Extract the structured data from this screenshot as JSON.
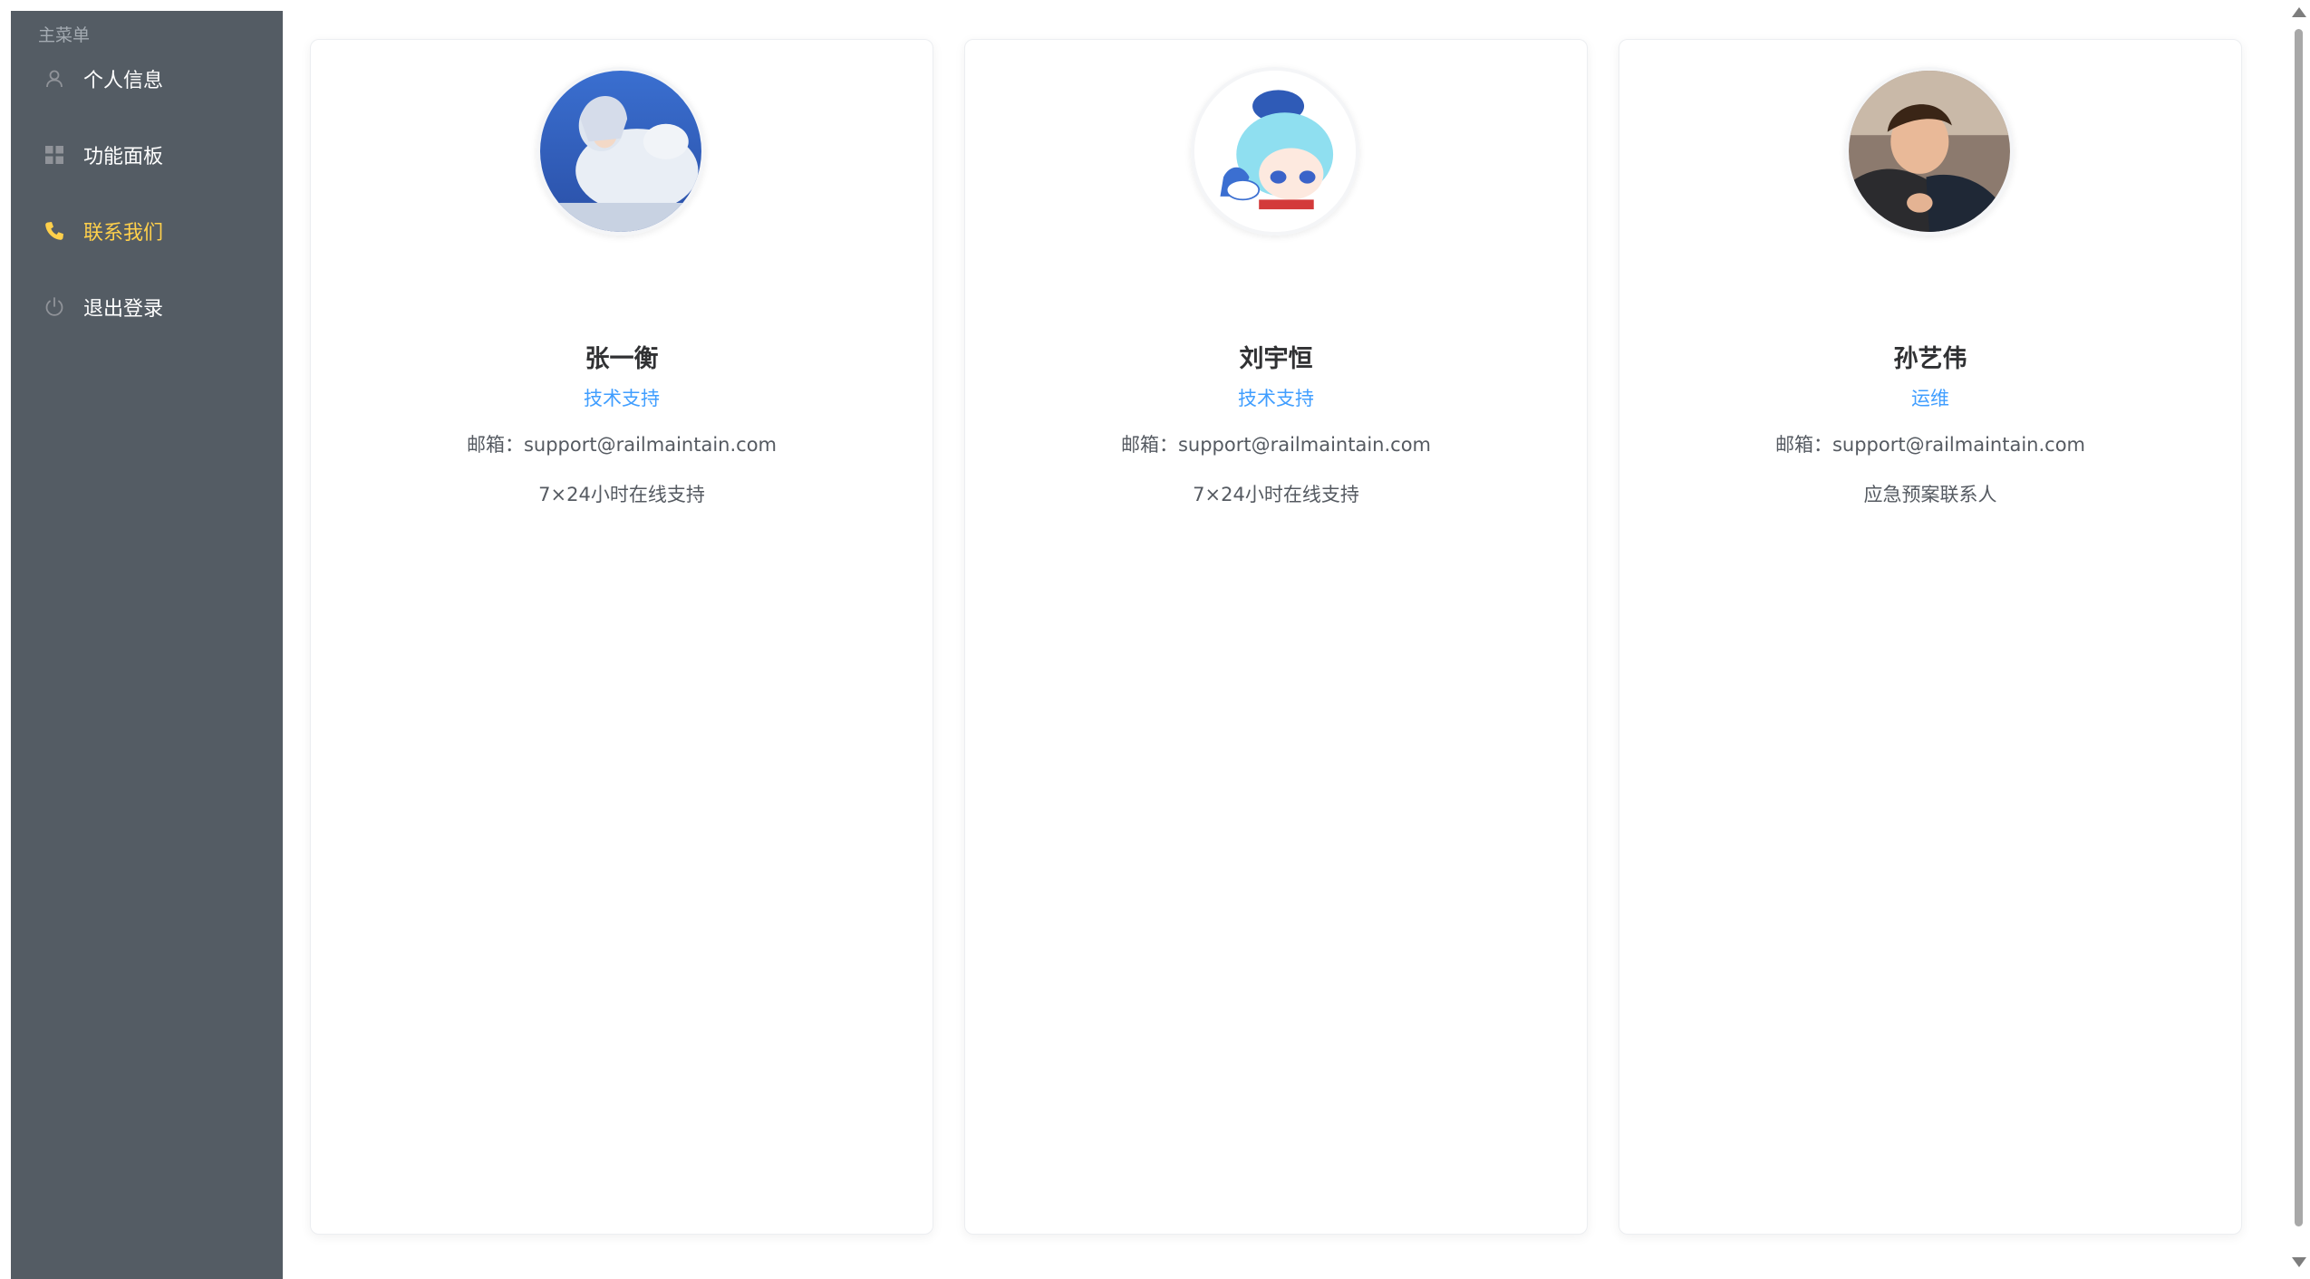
{
  "sidebar": {
    "group_title": "主菜单",
    "items": [
      {
        "label": "个人信息",
        "icon": "user-icon",
        "active": false
      },
      {
        "label": "功能面板",
        "icon": "grid-icon",
        "active": false
      },
      {
        "label": "联系我们",
        "icon": "phone-icon",
        "active": true
      },
      {
        "label": "退出登录",
        "icon": "power-icon",
        "active": false
      }
    ]
  },
  "colors": {
    "sidebar_bg": "#545c64",
    "active_text": "#ffd04b",
    "role_text": "#409eff"
  },
  "contacts": [
    {
      "name": "张一衡",
      "role": "技术支持",
      "email": "邮箱：support@railmaintain.com",
      "note": "7×24小时在线支持",
      "avatar": "anime-boy-with-polar-bear-avatar"
    },
    {
      "name": "刘宇恒",
      "role": "技术支持",
      "email": "邮箱：support@railmaintain.com",
      "note": "7×24小时在线支持",
      "avatar": "chibi-cyan-hair-character-avatar"
    },
    {
      "name": "孙艺伟",
      "role": "运维",
      "email": "邮箱：support@railmaintain.com",
      "note": "应急预案联系人",
      "avatar": "child-photo-avatar"
    }
  ]
}
